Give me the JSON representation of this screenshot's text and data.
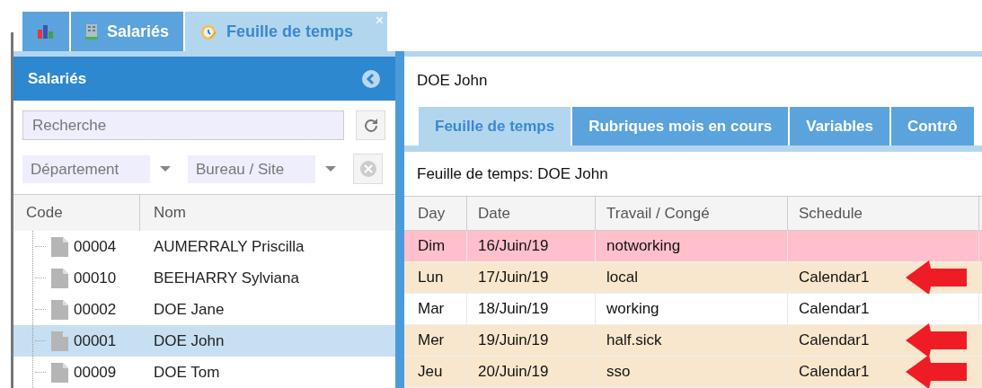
{
  "top_tabs": [
    {
      "kind": "chart",
      "selected": false
    },
    {
      "kind": "building",
      "label": "Salariés",
      "selected": false
    },
    {
      "kind": "clock",
      "label": "Feuille de temps",
      "selected": true,
      "close": "×"
    }
  ],
  "sidebar": {
    "title": "Salariés",
    "search": {
      "placeholder": "Recherche"
    },
    "filters": [
      {
        "placeholder": "Département"
      },
      {
        "placeholder": "Bureau / Site"
      }
    ],
    "columns": [
      "Code",
      "Nom"
    ],
    "rows": [
      {
        "code": "00004",
        "name": "AUMERRALY Priscilla",
        "selected": false
      },
      {
        "code": "00010",
        "name": "BEEHARRY Sylviana",
        "selected": false
      },
      {
        "code": "00002",
        "name": "DOE Jane",
        "selected": false
      },
      {
        "code": "00001",
        "name": "DOE John",
        "selected": true
      },
      {
        "code": "00009",
        "name": "DOE Tom",
        "selected": false
      }
    ]
  },
  "detail": {
    "employee": "DOE John",
    "tabs": [
      {
        "label": "Feuille de temps",
        "selected": true
      },
      {
        "label": "Rubriques mois en cours",
        "selected": false
      },
      {
        "label": "Variables",
        "selected": false
      },
      {
        "label": "Contrô",
        "selected": false
      }
    ],
    "sheet_title": "Feuille de temps: DOE John",
    "columns": [
      "Day",
      "Date",
      "Travail / Congé",
      "Schedule"
    ],
    "rows": [
      {
        "day": "Dim",
        "date": "16/Juin/19",
        "type": "notworking",
        "schedule": "",
        "color": "#ffc0cb",
        "marked": false
      },
      {
        "day": "Lun",
        "date": "17/Juin/19",
        "type": "local",
        "schedule": "Calendar1",
        "color": "#f8e7cd",
        "marked": true
      },
      {
        "day": "Mar",
        "date": "18/Juin/19",
        "type": "working",
        "schedule": "Calendar1",
        "color": "#ffffff",
        "marked": false
      },
      {
        "day": "Mer",
        "date": "19/Juin/19",
        "type": "half.sick",
        "schedule": "Calendar1",
        "color": "#f8e7cd",
        "marked": true
      },
      {
        "day": "Jeu",
        "date": "20/Juin/19",
        "type": "sso",
        "schedule": "Calendar1",
        "color": "#f8e7cd",
        "marked": true
      }
    ]
  }
}
